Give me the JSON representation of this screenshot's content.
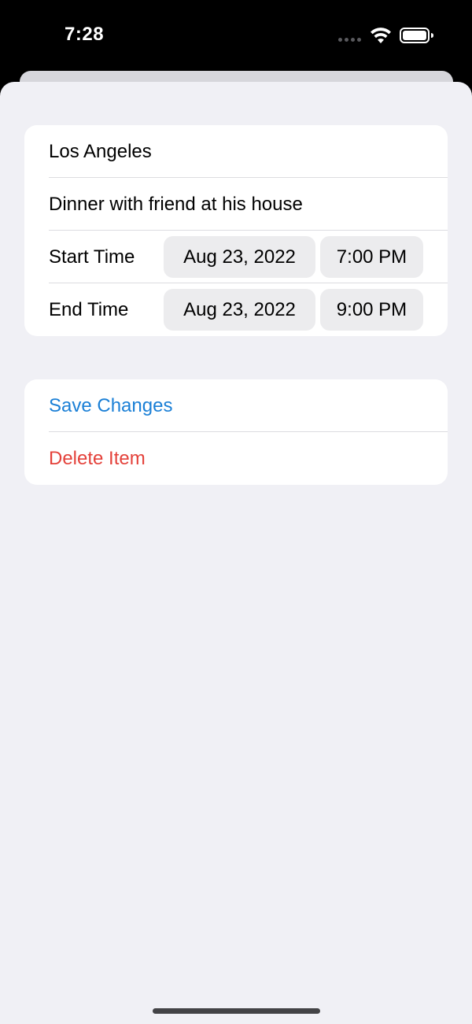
{
  "status_bar": {
    "time": "7:28",
    "icons": [
      "cellular-dots-icon",
      "wifi-icon",
      "battery-icon"
    ]
  },
  "details": {
    "location": "Los Angeles",
    "description": "Dinner with friend at his house",
    "start": {
      "label": "Start Time",
      "date": "Aug 23, 2022",
      "time": "7:00 PM"
    },
    "end": {
      "label": "End Time",
      "date": "Aug 23, 2022",
      "time": "9:00 PM"
    }
  },
  "actions": {
    "save_label": "Save Changes",
    "delete_label": "Delete Item"
  },
  "colors": {
    "accent": "#1a7fd6",
    "destructive": "#e4413a",
    "background": "#f0f0f5",
    "card": "#ffffff",
    "pill": "#ececee"
  }
}
